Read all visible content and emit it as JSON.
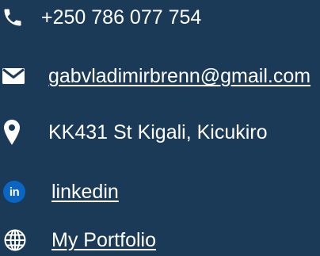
{
  "contacts": {
    "phone": {
      "icon": "phone-icon",
      "text": "+250 786 077 754"
    },
    "email": {
      "icon": "mail-icon",
      "text": "gabvladimirbrenn@gmail.com"
    },
    "address": {
      "icon": "map-pin-icon",
      "text": "KK431 St Kigali, Kicukiro"
    },
    "linkedin": {
      "icon": "linkedin-icon",
      "badge": "in",
      "text": "linkedin"
    },
    "portfolio": {
      "icon": "globe-icon",
      "text": "My Portfolio"
    }
  },
  "colors": {
    "background": "#1b3a57",
    "text": "#ffffff",
    "linkedin_brand": "#0a66c2"
  }
}
